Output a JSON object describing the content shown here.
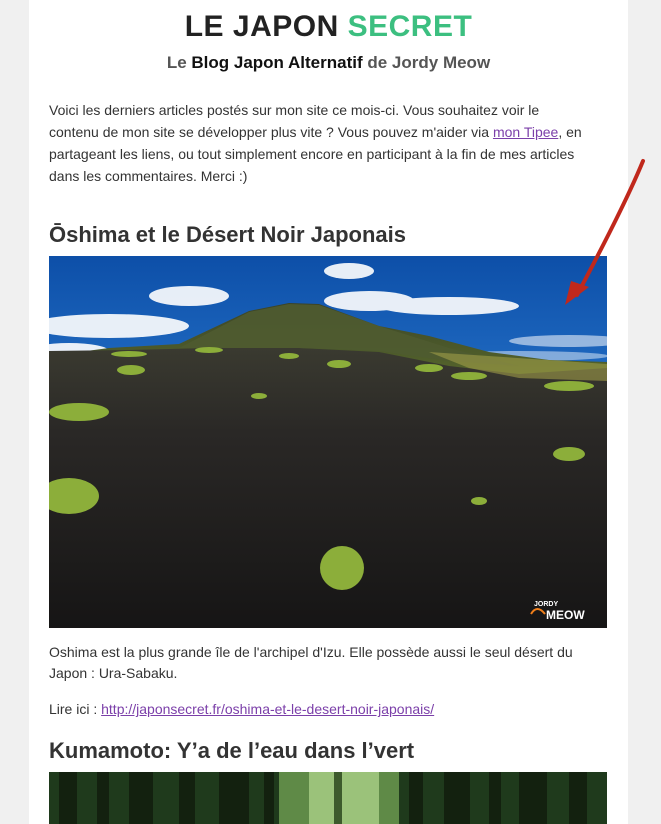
{
  "masthead": {
    "title_part1": "LE JAPON ",
    "title_part2": "SECRET",
    "sub_part1": "Le ",
    "sub_strong": "Blog Japon Alternatif",
    "sub_part2": " de Jordy Meow"
  },
  "intro": {
    "text_before": "Voici les derniers articles postés sur mon site ce mois-ci. Vous souhaitez voir le contenu de mon site se développer plus vite ? Vous pouvez m'aider via ",
    "link": "mon Tipee",
    "text_after": ", en partageant les liens, ou tout simplement encore en participant à la fin de mes articles dans les commentaires. Merci :)"
  },
  "articles": [
    {
      "title": "Ōshima et le Désert Noir Japonais",
      "watermark_small": "JORDY",
      "watermark_big": "MEOW",
      "caption": "Oshima est la plus grande île de l'archipel d'Izu. Elle possède aussi le seul désert du Japon : Ura-Sabaku.",
      "read_label": "Lire ici : ",
      "read_link": "http://japonsecret.fr/oshima-et-le-desert-noir-japonais/"
    },
    {
      "title": "Kumamoto: Y’a de l’eau dans l’vert"
    }
  ],
  "colors": {
    "accent": "#3cbf80",
    "link": "#7b3fa9",
    "arrow": "#c0281c"
  }
}
